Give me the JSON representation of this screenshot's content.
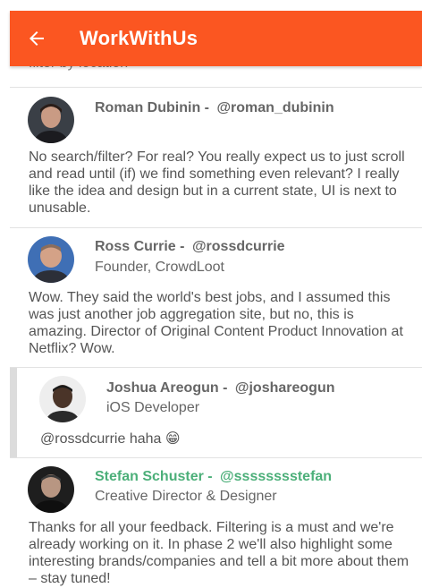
{
  "header": {
    "title": "WorkWithUs",
    "back_icon": "arrow-back-icon",
    "color": "#fb5621"
  },
  "partial_text": "filter by location",
  "comments": [
    {
      "name": "Roman Dubinin",
      "separator": "-",
      "handle": "@roman_dubinin",
      "subtitle": "",
      "text": "No search/filter? For real? You really expect us to just scroll and read until (if) we find something even relevant? I really like the idea and design but in a current state, UI is next to unusable."
    },
    {
      "name": "Ross Currie",
      "separator": "-",
      "handle": "@rossdcurrie",
      "subtitle": "Founder, CrowdLoot",
      "text": "Wow. They said the world's best jobs, and I assumed this was just another job aggregation site, but no, this is amazing. Director of Original Content Product Innovation at Netflix? Wow."
    },
    {
      "name": "Joshua Areogun",
      "separator": "-",
      "handle": "@joshareogun",
      "subtitle": "iOS Developer",
      "text": "@rossdcurrie haha 😁"
    },
    {
      "name": "Stefan Schuster",
      "separator": "-",
      "handle": "@sssssssstefan",
      "subtitle": "Creative Director & Designer",
      "text": "Thanks for all your feedback. Filtering is a must and we're already working on it. In phase 2 we'll also highlight some interesting brands/companies and tell a bit more about them – stay tuned!",
      "highlight_color": "#4caf79"
    }
  ]
}
